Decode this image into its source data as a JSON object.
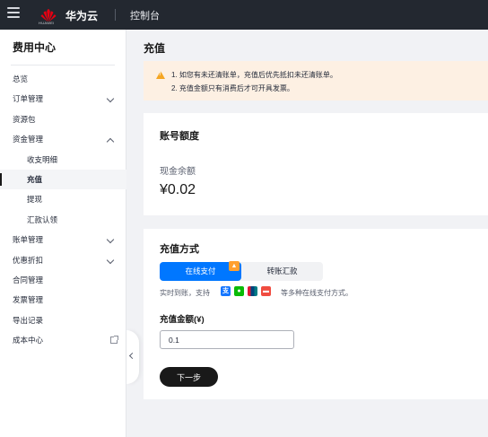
{
  "topbar": {
    "brand": "华为云",
    "logo_caption": "HUAWEI",
    "console": "控制台"
  },
  "sidebar": {
    "title": "费用中心",
    "items": [
      {
        "label": "总览"
      },
      {
        "label": "订单管理"
      },
      {
        "label": "资源包"
      },
      {
        "label": "资金管理"
      },
      {
        "label": "收支明细"
      },
      {
        "label": "充值"
      },
      {
        "label": "提现"
      },
      {
        "label": "汇款认领"
      },
      {
        "label": "账单管理"
      },
      {
        "label": "优惠折扣"
      },
      {
        "label": "合同管理"
      },
      {
        "label": "发票管理"
      },
      {
        "label": "导出记录"
      },
      {
        "label": "成本中心"
      }
    ]
  },
  "main": {
    "title": "充值",
    "notice": {
      "line1": "1. 如您有未还清账单，充值后优先抵扣未还清账单。",
      "line2": "2. 充值金额只有消费后才可开具发票。"
    },
    "account": {
      "title": "账号额度",
      "balance_label": "现金余额",
      "balance_value": "¥0.02"
    },
    "payment": {
      "title": "充值方式",
      "tab_online": "在线支付",
      "tab_transfer": "转账汇款",
      "desc_prefix": "实时到账，支持",
      "desc_suffix": "等多种在线支付方式。",
      "amount_label": "充值金额(¥)",
      "amount_value": "0.1",
      "next_label": "下一步"
    }
  },
  "colors": {
    "topbar": "#232830",
    "primary": "#0077ff",
    "notice_bg": "#fdf0e3",
    "warning": "#f5a623"
  }
}
